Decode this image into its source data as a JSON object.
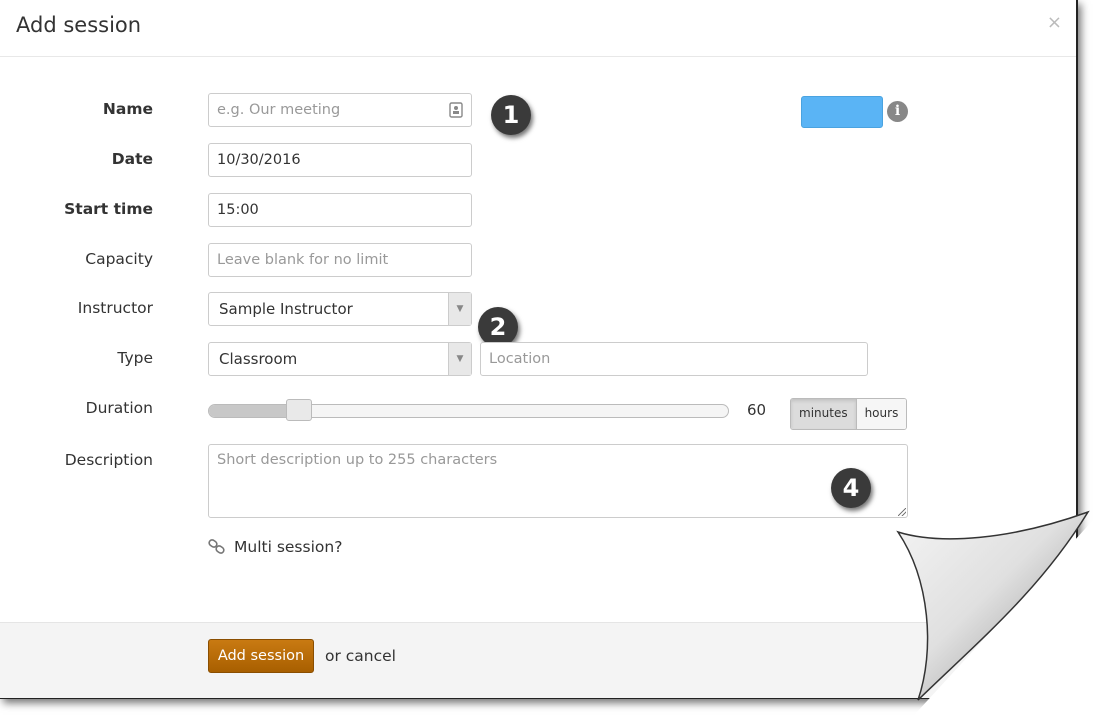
{
  "dialog": {
    "title": "Add session",
    "close_glyph": "×"
  },
  "form": {
    "name": {
      "label": "Name",
      "placeholder": "e.g. Our meeting",
      "icon": "contact-card-icon"
    },
    "date": {
      "label": "Date",
      "value": "10/30/2016"
    },
    "start_time": {
      "label": "Start time",
      "value": "15:00"
    },
    "capacity": {
      "label": "Capacity",
      "placeholder": "Leave blank for no limit"
    },
    "instructor": {
      "label": "Instructor",
      "selected": "Sample Instructor"
    },
    "type": {
      "label": "Type",
      "selected": "Classroom",
      "location_placeholder": "Location"
    },
    "duration": {
      "label": "Duration",
      "value": "60",
      "slider_fraction": 0.15,
      "units": [
        "minutes",
        "hours"
      ],
      "active_unit": "minutes"
    },
    "description": {
      "label": "Description",
      "placeholder": "Short description up to 255 characters"
    },
    "color": "#5ab4f5",
    "info_glyph": "i",
    "multi_session": "Multi session?"
  },
  "badges": [
    "1",
    "2",
    "4"
  ],
  "footer": {
    "submit_label": "Add session",
    "cancel_text": "or cancel",
    "accent": "#b8690a"
  }
}
